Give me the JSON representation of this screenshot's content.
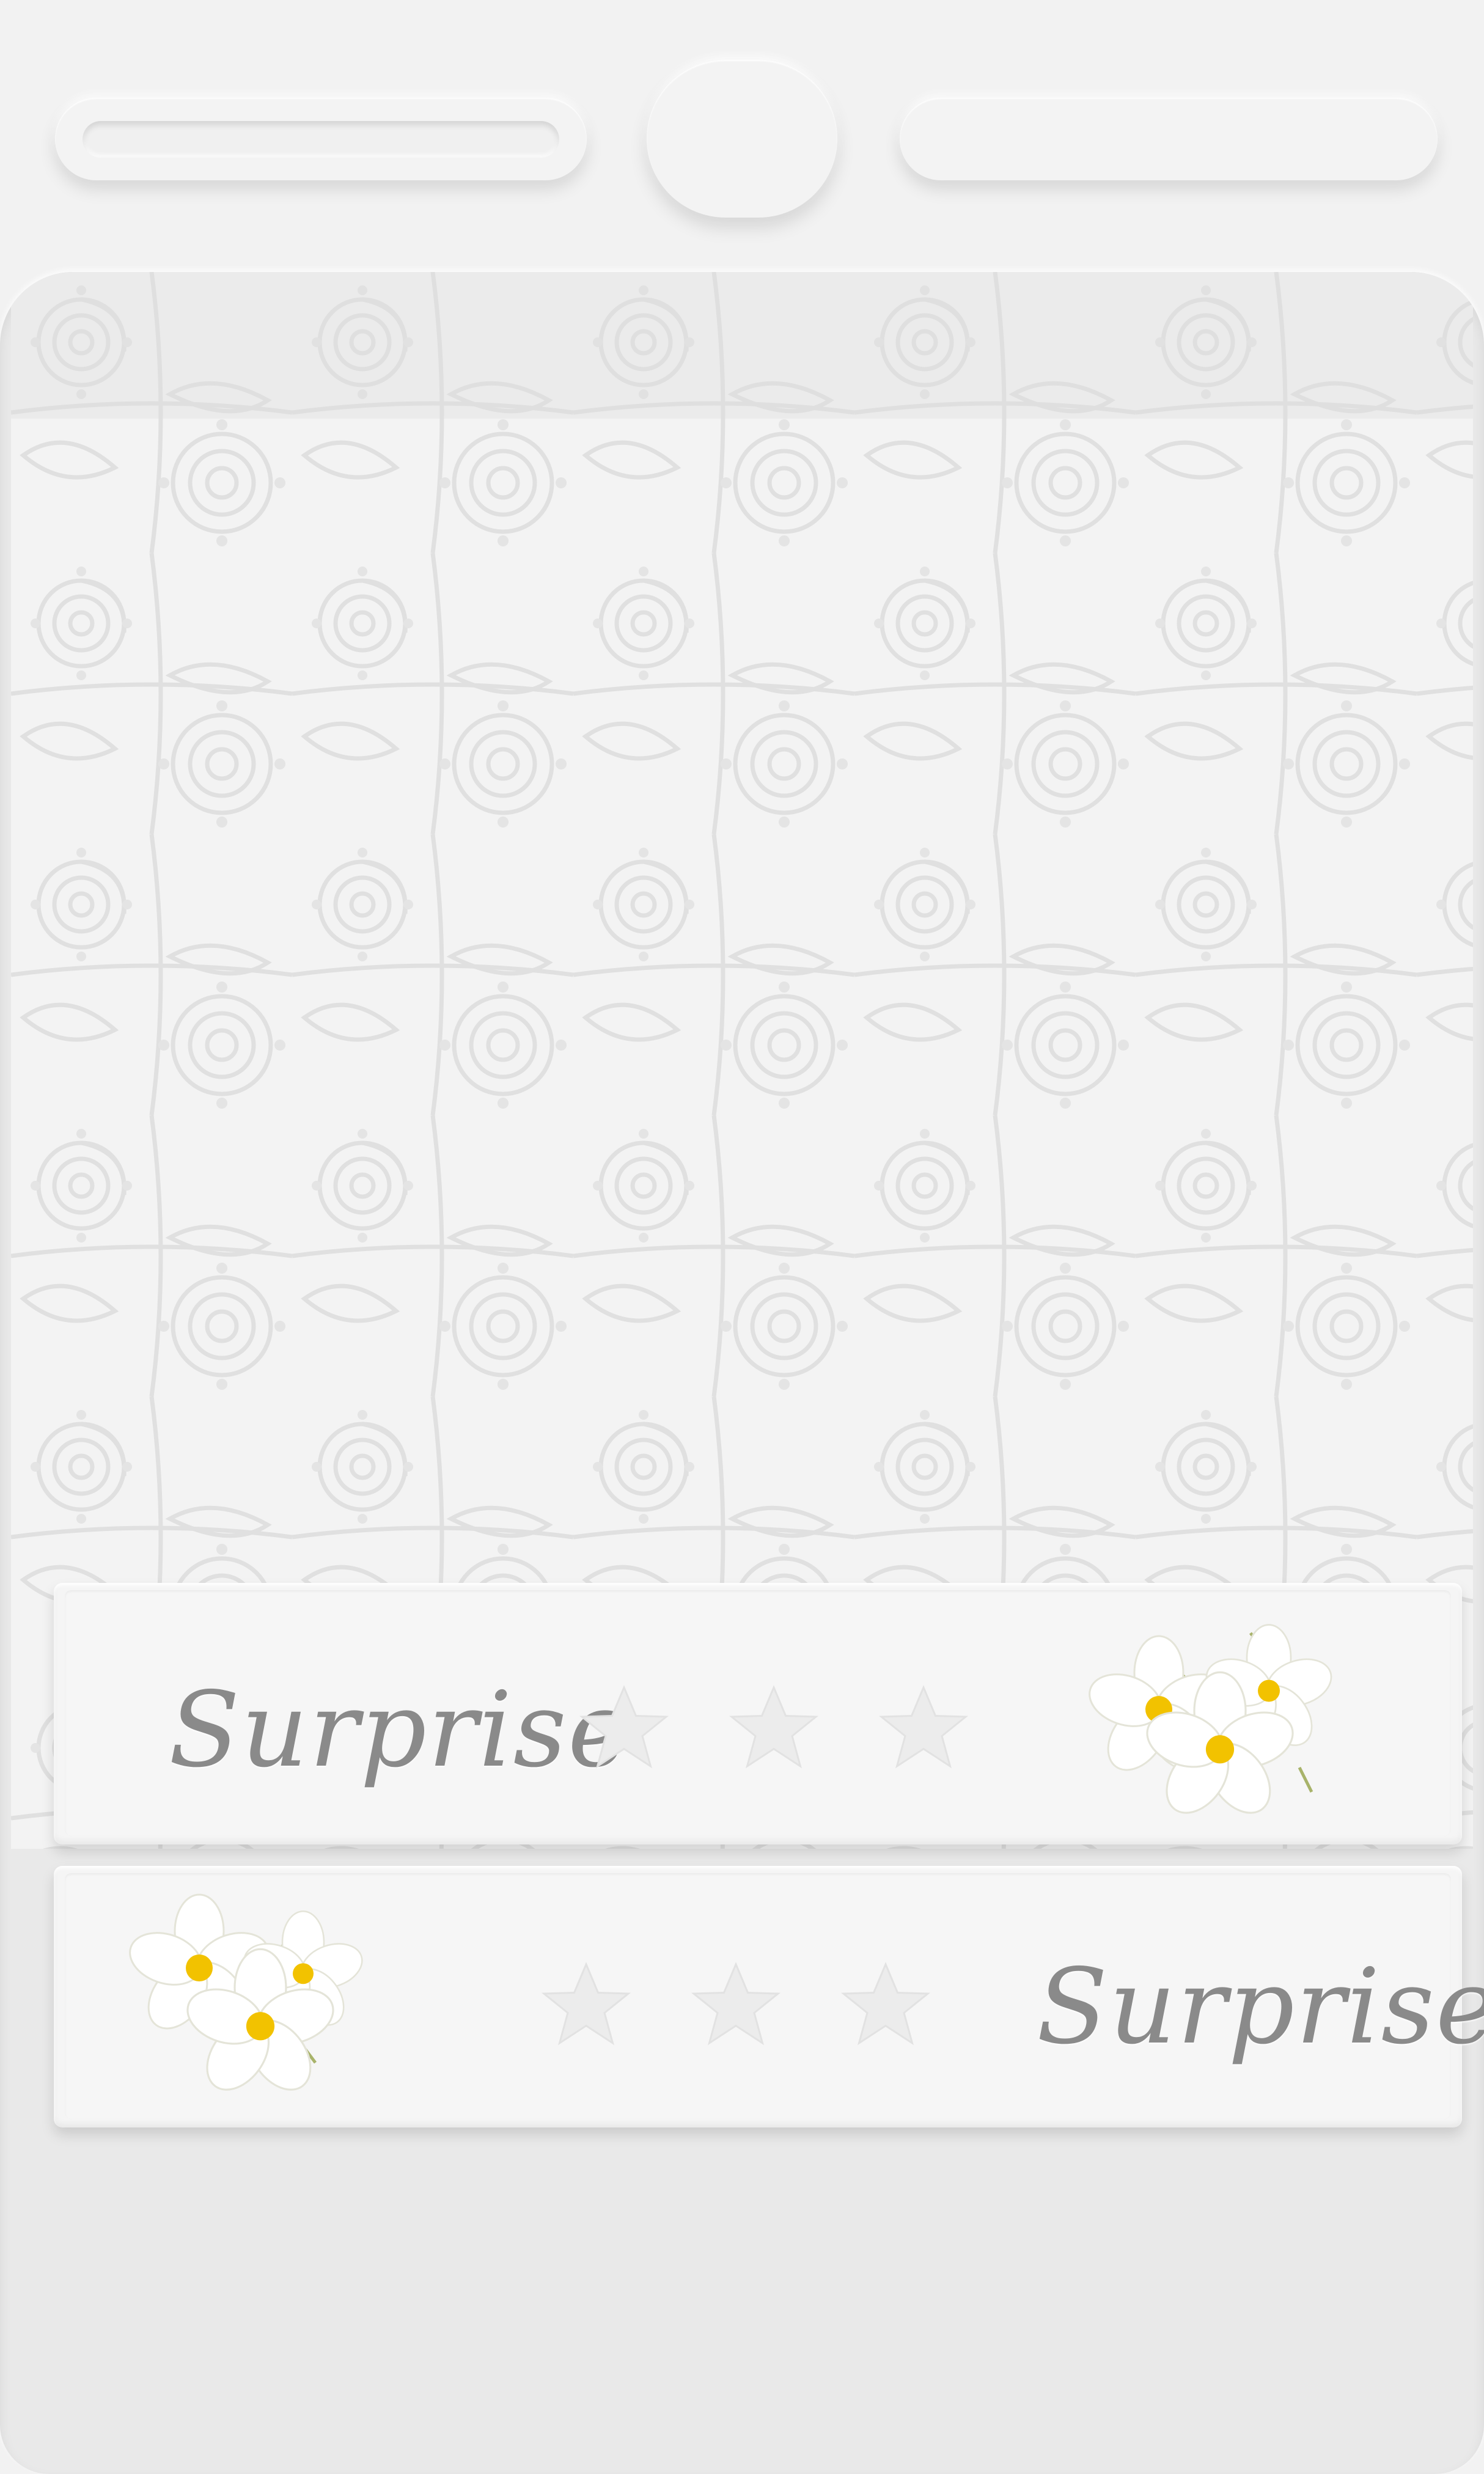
{
  "header": {
    "left_pill_label": "",
    "center_button_label": "",
    "right_pill_label": ""
  },
  "cards": [
    {
      "label": "Surprise",
      "rating": {
        "filled": 0,
        "total": 3
      },
      "image_icon": "white-plumeria-flowers-icon",
      "layout_order": "text-stars-image"
    },
    {
      "label": "Surprise",
      "rating": {
        "filled": 0,
        "total": 3
      },
      "image_icon": "white-plumeria-flowers-icon",
      "layout_order": "image-stars-text"
    }
  ],
  "colors": {
    "background": "#f2f2f2",
    "panel": "#f5f5f5",
    "text": "#8a8a8a",
    "pattern_line": "#dcdcdc",
    "flower_petal": "#ffffff",
    "flower_center": "#f2c200"
  }
}
